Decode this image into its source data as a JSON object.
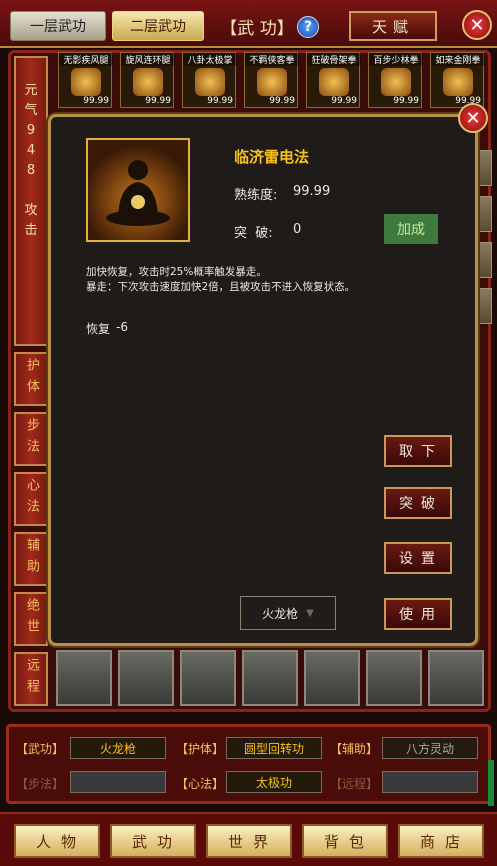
{
  "header": {
    "tab1_label": "一层武功",
    "tab2_label": "二层武功",
    "title": "【武 功】",
    "help_label": "?",
    "talent_label": "天赋",
    "close_label": "✕"
  },
  "sidebar": {
    "active": {
      "lines": [
        "元",
        "气",
        "9",
        "4",
        "8",
        "",
        "攻",
        "击"
      ]
    },
    "items": [
      {
        "label": "护体"
      },
      {
        "label": "步法"
      },
      {
        "label": "心法"
      },
      {
        "label": "辅助"
      },
      {
        "label": "绝世"
      },
      {
        "label": "远程"
      }
    ]
  },
  "skills": [
    {
      "name": "无影疾风腿",
      "value": "99.99",
      "icon": "fist-icon"
    },
    {
      "name": "旋风连环腿",
      "value": "99.99",
      "icon": "fist-icon"
    },
    {
      "name": "八卦太极掌",
      "value": "99.99",
      "icon": "fist-icon"
    },
    {
      "name": "不羁侠客拳",
      "value": "99.99",
      "icon": "fist-icon"
    },
    {
      "name": "狂破骨架拳",
      "value": "99.99",
      "icon": "fist-icon"
    },
    {
      "name": "百步少林拳",
      "value": "99.99",
      "icon": "fist-icon"
    },
    {
      "name": "如来金刚拳",
      "value": "99.99",
      "icon": "fist-icon"
    }
  ],
  "dialog": {
    "close_label": "✕",
    "skill_name": "临济雷电法",
    "proficiency_label": "熟练度:",
    "proficiency_value": "99.99",
    "breakthrough_label": "突  破:",
    "breakthrough_value": "0",
    "bonus_button": "加成",
    "description_line1": "加快恢复，攻击时25%概率触发暴走。",
    "description_line2": "暴走：下次攻击速度加快2倍，且被攻击不进入恢复状态。",
    "effect_label": "恢复",
    "effect_value": "-6",
    "buttons": [
      "取下",
      "突破",
      "设置",
      "使用"
    ],
    "dropdown_value": "火龙枪"
  },
  "equip": {
    "rows": [
      [
        {
          "label": "【武功】",
          "value": "火龙枪",
          "style": "gold"
        },
        {
          "label": "【护体】",
          "value": "圆型回转功",
          "style": "gold"
        },
        {
          "label": "【辅助】",
          "value": "八方灵动",
          "style": "grey"
        }
      ],
      [
        {
          "label": "【步法】",
          "value": "",
          "style": "empty",
          "dim": true
        },
        {
          "label": "【心法】",
          "value": "太极功",
          "style": "gold"
        },
        {
          "label": "【远程】",
          "value": "",
          "style": "empty",
          "dim": true
        }
      ]
    ]
  },
  "nav": {
    "items": [
      "人物",
      "武功",
      "世界",
      "背包",
      "商店"
    ]
  },
  "colors": {
    "accent_gold": "#f8c020",
    "frame_red": "#8a2418",
    "bonus_green": "#3e7a3e"
  }
}
